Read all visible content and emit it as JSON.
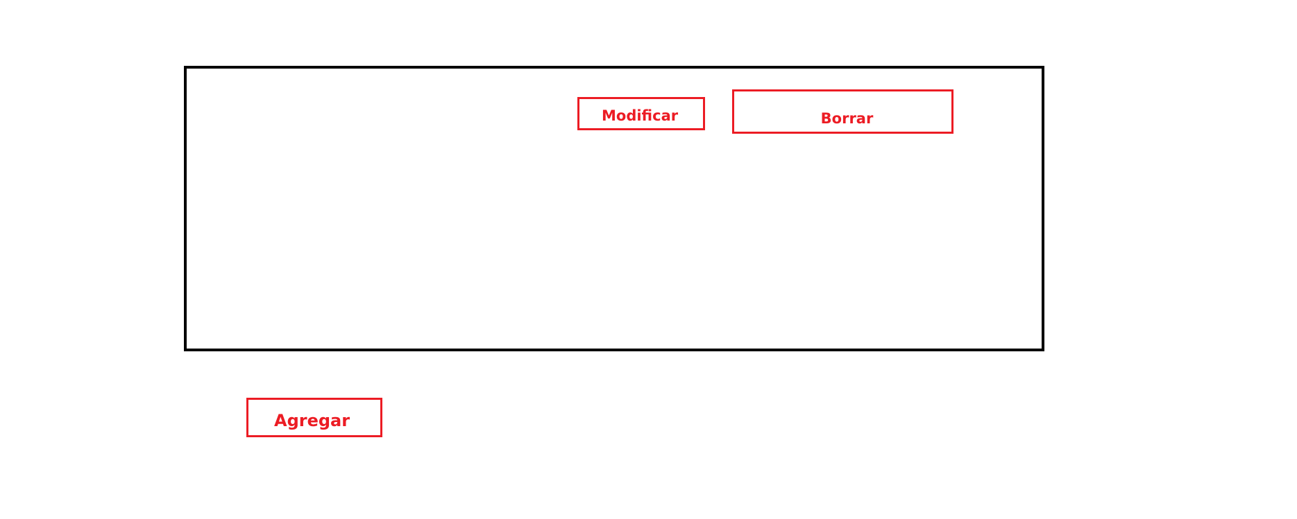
{
  "buttons": {
    "modificar_label": "Modificar",
    "borrar_label": "Borrar",
    "agregar_label": "Agregar"
  },
  "colors": {
    "button_accent": "#ec1c24",
    "panel_border": "#000000",
    "background": "#ffffff"
  }
}
